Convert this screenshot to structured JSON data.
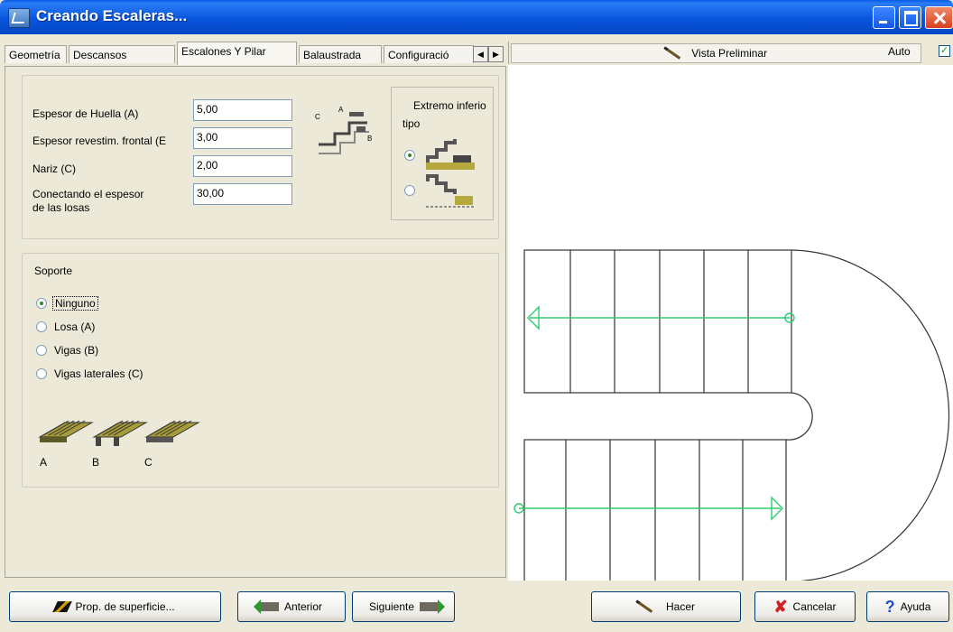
{
  "window": {
    "title": "Creando Escaleras..."
  },
  "tabs": [
    "Geometría",
    "Descansos",
    "Escalones Y Pilar",
    "Balaustrada",
    "Configuració"
  ],
  "active_tab": "Escalones Y Pilar",
  "preview": {
    "button_label": "Vista Preliminar",
    "auto_label": "Auto",
    "auto_checked": true
  },
  "fields": [
    {
      "label": "Espesor de Huella (A)",
      "value": "5,00"
    },
    {
      "label": "Espesor revestim. frontal (E",
      "value": "3,00"
    },
    {
      "label": "Nariz (C)",
      "value": "2,00"
    },
    {
      "label": "Conectando el espesor",
      "label2": "de las losas",
      "value": "30,00"
    }
  ],
  "extremo": {
    "title_line1": "Extremo inferio",
    "title_line2": "tipo",
    "selected_index": 0
  },
  "soporte": {
    "title": "Soporte",
    "options": [
      "Ninguno",
      "Losa (A)",
      "Vigas (B)",
      "Vigas laterales (C)"
    ],
    "selected_index": 0,
    "beam_labels": [
      "A",
      "B",
      "C"
    ]
  },
  "buttons": {
    "surface": "Prop. de superficie...",
    "back": "Anterior",
    "next": "Siguiente",
    "make": "Hacer",
    "cancel": "Cancelar",
    "help": "Ayuda"
  },
  "colors": {
    "titlebar": "#0a5ce6",
    "accent_green": "#2ecc71"
  }
}
